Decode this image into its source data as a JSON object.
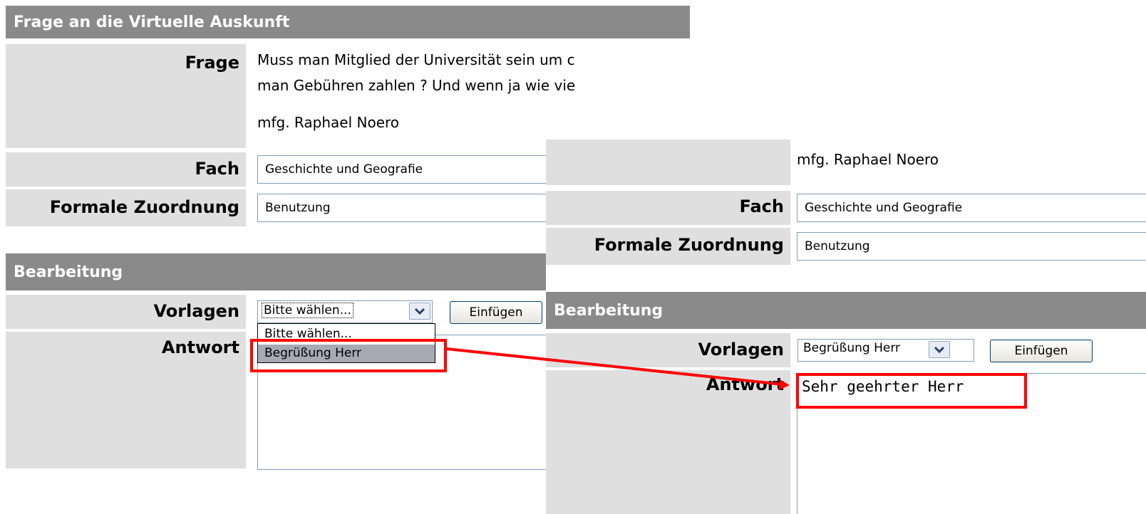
{
  "left": {
    "header_title": "Frage an die Virtuelle Auskunft",
    "frage_label": "Frage",
    "frage_lines": [
      "Muss man Mitglied der Universität sein um c",
      "man Gebühren zahlen ? Und wenn ja wie vie"
    ],
    "frage_signature": "mfg. Raphael Noero",
    "fach_label": "Fach",
    "fach_value": "Geschichte und Geografie",
    "zuordnung_label": "Formale Zuordnung",
    "zuordnung_value": "Benutzung",
    "bearbeitung_title": "Bearbeitung",
    "vorlagen_label": "Vorlagen",
    "vorlagen_selected": "Bitte wählen...",
    "einfuegen_label": "Einfügen",
    "antwort_label": "Antwort",
    "dropdown_options": [
      "Bitte wählen...",
      "Begrüßung Herr"
    ]
  },
  "right": {
    "signature": "mfg. Raphael Noero",
    "fach_label": "Fach",
    "fach_value": "Geschichte und Geografie",
    "zuordnung_label": "Formale Zuordnung",
    "zuordnung_value": "Benutzung",
    "bearbeitung_title": "Bearbeitung",
    "vorlagen_label": "Vorlagen",
    "vorlagen_selected": "Begrüßung Herr",
    "einfuegen_label": "Einfügen",
    "antwort_label": "Antwort",
    "antwort_value": "Sehr geehrter Herr"
  },
  "annotation": {
    "highlight_color": "#ff0000"
  },
  "icons": {
    "select_arrow": "chevron-down-icon"
  }
}
